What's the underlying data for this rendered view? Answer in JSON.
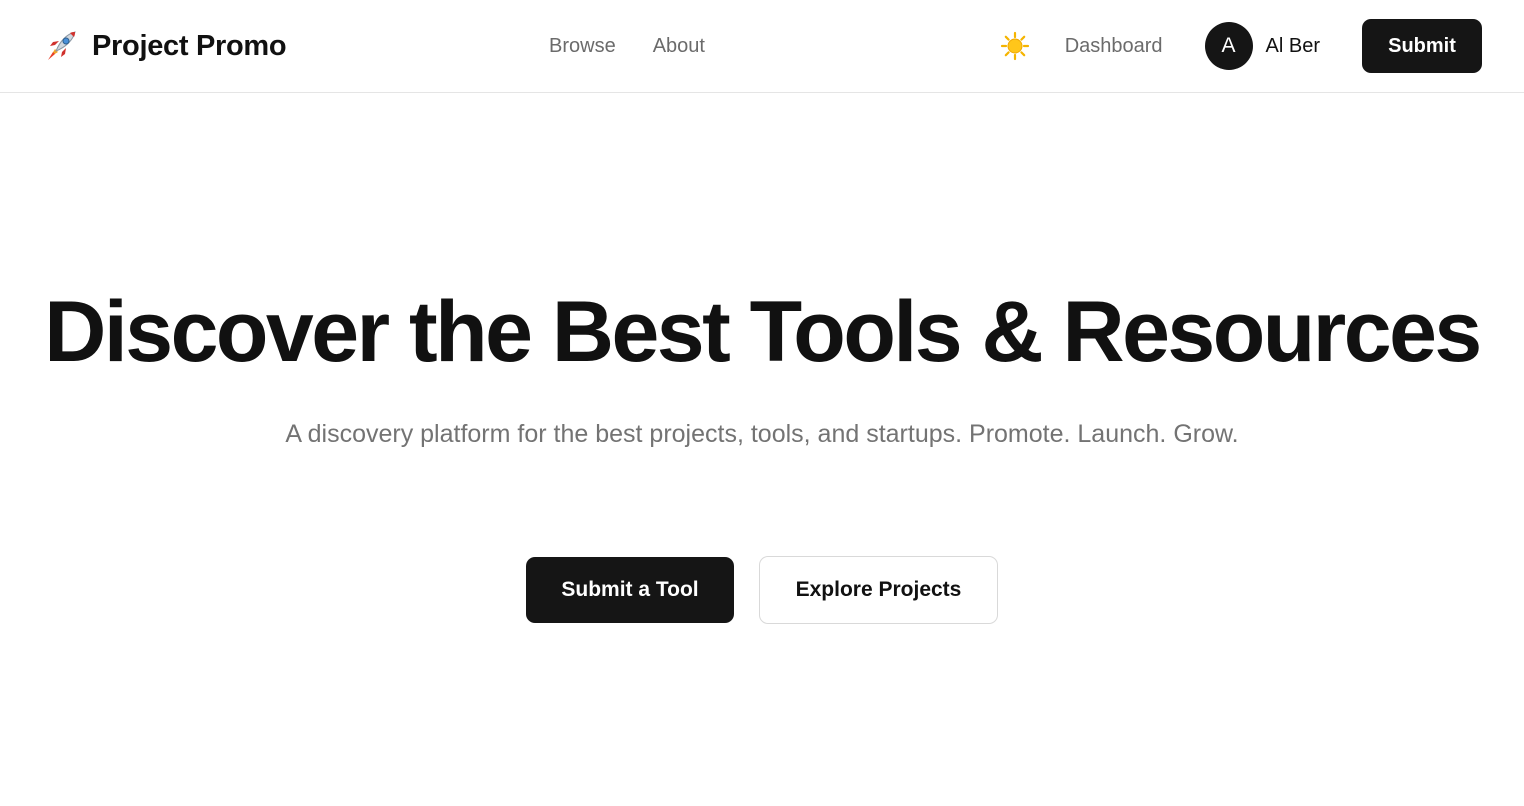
{
  "navbar": {
    "brand": {
      "icon": "rocket-icon",
      "name": "Project Promo"
    },
    "links": [
      {
        "label": "Browse"
      },
      {
        "label": "About"
      }
    ],
    "theme_toggle_icon": "sun-icon",
    "dashboard_label": "Dashboard",
    "user": {
      "avatar_initial": "A",
      "name": "Al Ber"
    },
    "submit_label": "Submit"
  },
  "hero": {
    "title": "Discover the Best Tools & Resources",
    "subtitle": "A discovery platform for the best projects, tools, and startups. Promote. Launch. Grow.",
    "primary_action": "Submit a Tool",
    "secondary_action": "Explore Projects"
  },
  "colors": {
    "primary": "#151515",
    "muted_text": "#737373",
    "nav_text": "#6b6b6b",
    "border": "#e5e5e5"
  }
}
